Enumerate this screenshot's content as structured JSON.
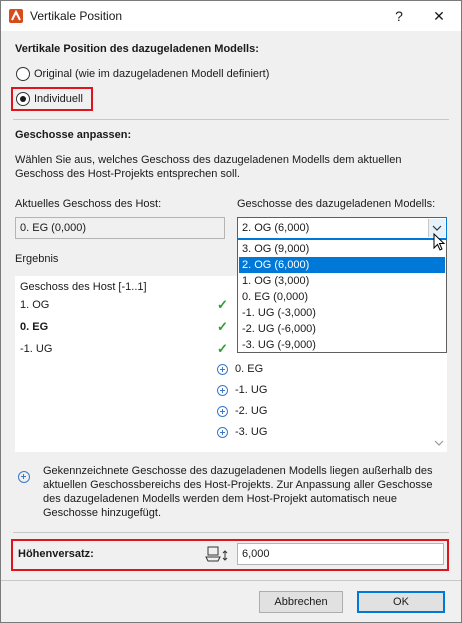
{
  "window": {
    "title": "Vertikale Position",
    "help": "?",
    "close": "✕"
  },
  "vertical_position": {
    "heading": "Vertikale Position des dazugeladenen Modells:",
    "option_original": "Original (wie im dazugeladenen Modell definiert)",
    "option_individual": "Individuell",
    "selected": "Individuell"
  },
  "stories": {
    "heading": "Geschosse anpassen:",
    "description_line1": "Wählen Sie aus, welches Geschoss des dazugeladenen Modells dem aktuellen",
    "description_line2": "Geschoss des Host-Projekts entsprechen soll.",
    "host_label": "Aktuelles Geschoss des Host:",
    "host_value": "0. EG (0,000)",
    "linked_label": "Geschosse des dazugeladenen Modells:",
    "linked_value": "2. OG (6,000)",
    "dropdown_options": [
      "3. OG (9,000)",
      "2. OG (6,000)",
      "1. OG (3,000)",
      "0. EG (0,000)",
      "-1. UG (-3,000)",
      "-2. UG (-6,000)",
      "-3. UG (-9,000)"
    ],
    "dropdown_selected": "2. OG (6,000)"
  },
  "result": {
    "label": "Ergebnis",
    "header": "Geschoss des Host [-1..1]",
    "host_rows": [
      "1. OG",
      "0. EG",
      "-1. UG"
    ],
    "added_rows": [
      "0. EG",
      "-1. UG",
      "-2. UG",
      "-3. UG"
    ]
  },
  "info": {
    "line1": "Gekennzeichnete Geschosse des dazugeladenen Modells liegen außerhalb des",
    "line2": "aktuellen Geschossbereichs des Host-Projekts. Zur Anpassung aller Geschosse",
    "line3": "des dazugeladenen Modells werden dem Host-Projekt automatisch neue",
    "line4": "Geschosse hinzugefügt."
  },
  "offset": {
    "label": "Höhenversatz:",
    "value": "6,000"
  },
  "buttons": {
    "cancel": "Abbrechen",
    "ok": "OK"
  },
  "colors": {
    "highlight_red": "#e0141e",
    "selection_blue": "#0078d7",
    "check_green": "#2ca02c"
  }
}
